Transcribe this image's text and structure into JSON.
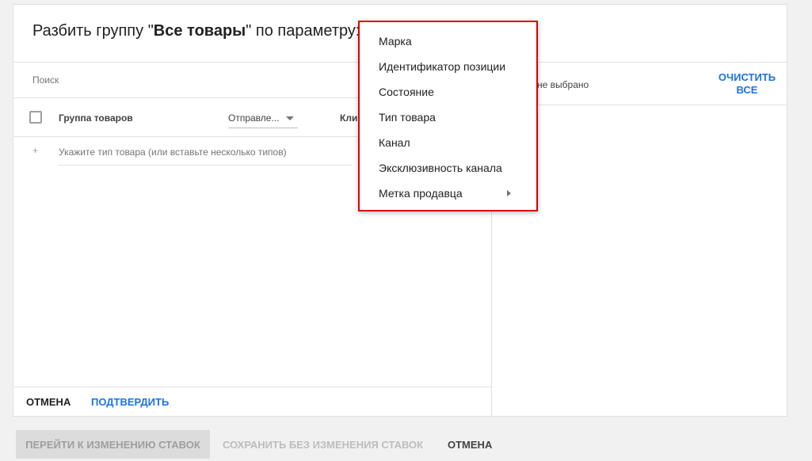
{
  "dialog": {
    "title_prefix": "Разбить группу \"",
    "title_group": "Все товары",
    "title_suffix": "\" по параметру:"
  },
  "search": {
    "placeholder": "Поиск"
  },
  "table": {
    "col_group": "Группа товаров",
    "col_filter": "Отправле...",
    "col_clicks": "Кли"
  },
  "add_row": {
    "plus": "+",
    "placeholder": "Укажите тип товара (или вставьте несколько типов)"
  },
  "left_footer": {
    "cancel": "Отмена",
    "confirm": "Подтвердить"
  },
  "right": {
    "nothing_selected": "о не выбрано",
    "clear_all": "Очистить все"
  },
  "bottom": {
    "go_bids": "Перейти к изменению ставок",
    "save_without": "Сохранить без изменения ставок",
    "cancel": "Отмена"
  },
  "menu": {
    "items": [
      "Марка",
      "Идентификатор позиции",
      "Состояние",
      "Тип товара",
      "Канал",
      "Эксклюзивность канала",
      "Метка продавца"
    ]
  },
  "colors": {
    "accent": "#1a73e8",
    "highlight_border": "#e00000"
  }
}
